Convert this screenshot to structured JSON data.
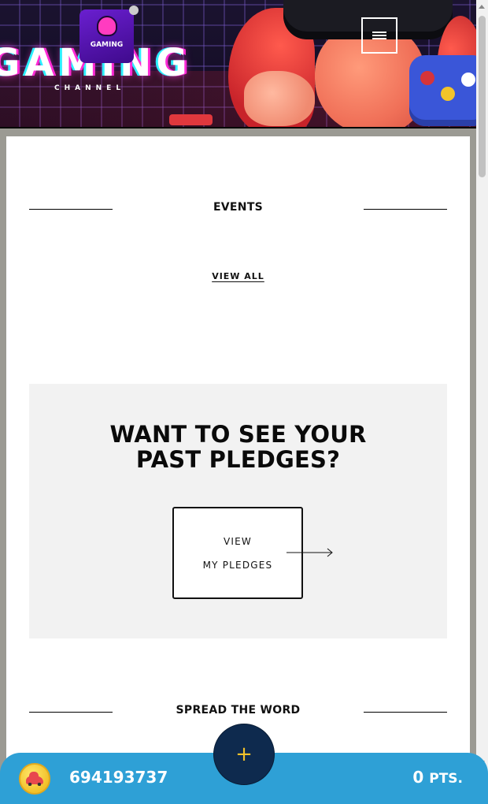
{
  "banner": {
    "title": "GAMING",
    "subtitle": "CHANNEL",
    "logo_text": "GAMING"
  },
  "nav": {
    "menu_icon": "hamburger-menu-icon"
  },
  "events": {
    "heading": "EVENTS",
    "view_all": "VIEW ALL"
  },
  "pledges": {
    "heading_line1": "WANT TO SEE YOUR",
    "heading_line2": "PAST PLEDGES?",
    "button_line1": "VIEW",
    "button_line2": "MY PLEDGES",
    "arrow_icon": "arrow-right-icon"
  },
  "spread": {
    "heading": "SPREAD THE WORD"
  },
  "bottom_bar": {
    "coin_icon": "car-coin-icon",
    "phone": "694193737",
    "points_value": "0",
    "points_unit": "PTS.",
    "fab_icon": "plus-icon",
    "fab_label": "+"
  },
  "colors": {
    "bottom_bar": "#2ea0d6",
    "fab": "#0e2a4e",
    "accent_yellow": "#f2c12a",
    "panel_bg": "#f2f2f2",
    "page_bg": "#9b9a93"
  }
}
